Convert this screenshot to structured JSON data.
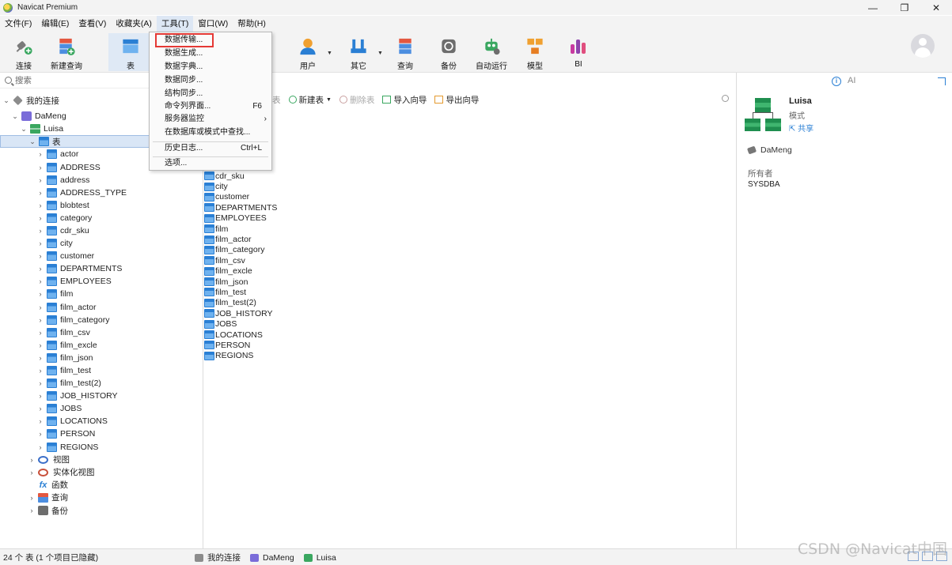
{
  "window": {
    "title": "Navicat Premium",
    "minimize": "—",
    "maximize": "❐",
    "close": "✕"
  },
  "menubar": [
    "文件(F)",
    "编辑(E)",
    "查看(V)",
    "收藏夹(A)",
    "工具(T)",
    "窗口(W)",
    "帮助(H)"
  ],
  "toolbar": {
    "connect": "连接",
    "new_query": "新建查询",
    "table": "表",
    "user": "用户",
    "other": "其它",
    "query": "查询",
    "backup": "备份",
    "automation": "自动运行",
    "model": "模型",
    "bi": "BI"
  },
  "tools_menu": {
    "items": [
      "数据传输...",
      "数据生成...",
      "数据字典...",
      "数据同步...",
      "结构同步...",
      "命令列界面...",
      "服务器监控",
      "在数据库或模式中查找...",
      "历史日志...",
      "选项..."
    ],
    "shortcut_cli": "F6",
    "shortcut_history": "Ctrl+L",
    "submenu_arrow": "›"
  },
  "left_panel": {
    "search_placeholder": "搜索",
    "tree": {
      "root": "我的连接",
      "connection": "DaMeng",
      "schema": "Luisa",
      "tables_node": "表",
      "tables": [
        "actor",
        "ADDRESS",
        "address",
        "ADDRESS_TYPE",
        "blobtest",
        "category",
        "cdr_sku",
        "city",
        "customer",
        "DEPARTMENTS",
        "EMPLOYEES",
        "film",
        "film_actor",
        "film_category",
        "film_csv",
        "film_excle",
        "film_json",
        "film_test",
        "film_test(2)",
        "JOB_HISTORY",
        "JOBS",
        "LOCATIONS",
        "PERSON",
        "REGIONS"
      ],
      "others": [
        "视图",
        "实体化视图",
        "函数",
        "查询",
        "备份"
      ]
    }
  },
  "middle_panel": {
    "toolbar": {
      "design": "表",
      "new_table": "新建表",
      "delete_table": "删除表",
      "import": "导入向导",
      "export": "导出向导"
    },
    "objects": [
      "cdr_sku",
      "city",
      "customer",
      "DEPARTMENTS",
      "EMPLOYEES",
      "film",
      "film_actor",
      "film_category",
      "film_csv",
      "film_excle",
      "film_json",
      "film_test",
      "film_test(2)",
      "JOB_HISTORY",
      "JOBS",
      "LOCATIONS",
      "PERSON",
      "REGIONS"
    ]
  },
  "right_panel": {
    "ai": "AI",
    "schema_name": "Luisa",
    "schema_type": "模式",
    "share": "共享",
    "connection": "DaMeng",
    "owner_label": "所有者",
    "owner": "SYSDBA"
  },
  "statusbar": {
    "count": "24 个 表 (1 个项目已隐藏)",
    "crumbs": [
      "我的连接",
      "DaMeng",
      "Luisa"
    ]
  },
  "watermark": "CSDN @Navicat中国"
}
